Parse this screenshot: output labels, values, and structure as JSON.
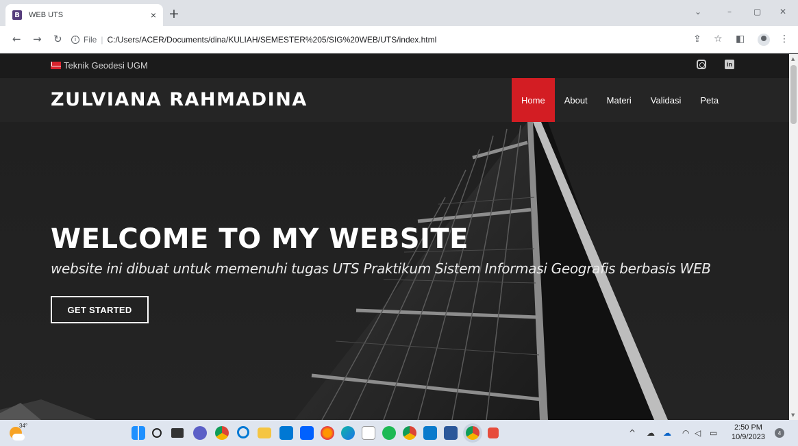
{
  "browser": {
    "tab_icon_letter": "B",
    "tab_title": "WEB UTS",
    "tab_close": "×",
    "new_tab": "+",
    "minimize": "–",
    "restore": "▢",
    "close": "✕",
    "collapse": "⌄",
    "omnibox_info": "i",
    "omnibox_scheme": "File",
    "omnibox_sep": "|",
    "url": "C:/Users/ACER/Documents/dina/KULIAH/SEMESTER%205/SIG%20WEB/UTS/index.html"
  },
  "site": {
    "topbar_text": "Teknik Geodesi UGM",
    "linkedin_label": "in",
    "logo": "ZULVIANA RAHMADINA",
    "nav": [
      "Home",
      "About",
      "Materi",
      "Validasi",
      "Peta"
    ],
    "hero_title": "WELCOME TO MY WEBSITE",
    "hero_subtitle": "website ini dibuat untuk memenuhi tugas UTS Praktikum Sistem Informasi Geografis berbasis WEB",
    "hero_button": "GET STARTED"
  },
  "taskbar": {
    "temperature": "34°",
    "time": "2:50 PM",
    "date": "10/9/2023",
    "notifications": "4"
  },
  "colors": {
    "accent": "#d31d23",
    "header_bg": "#252525",
    "topbar_bg": "#1b1b1b"
  }
}
